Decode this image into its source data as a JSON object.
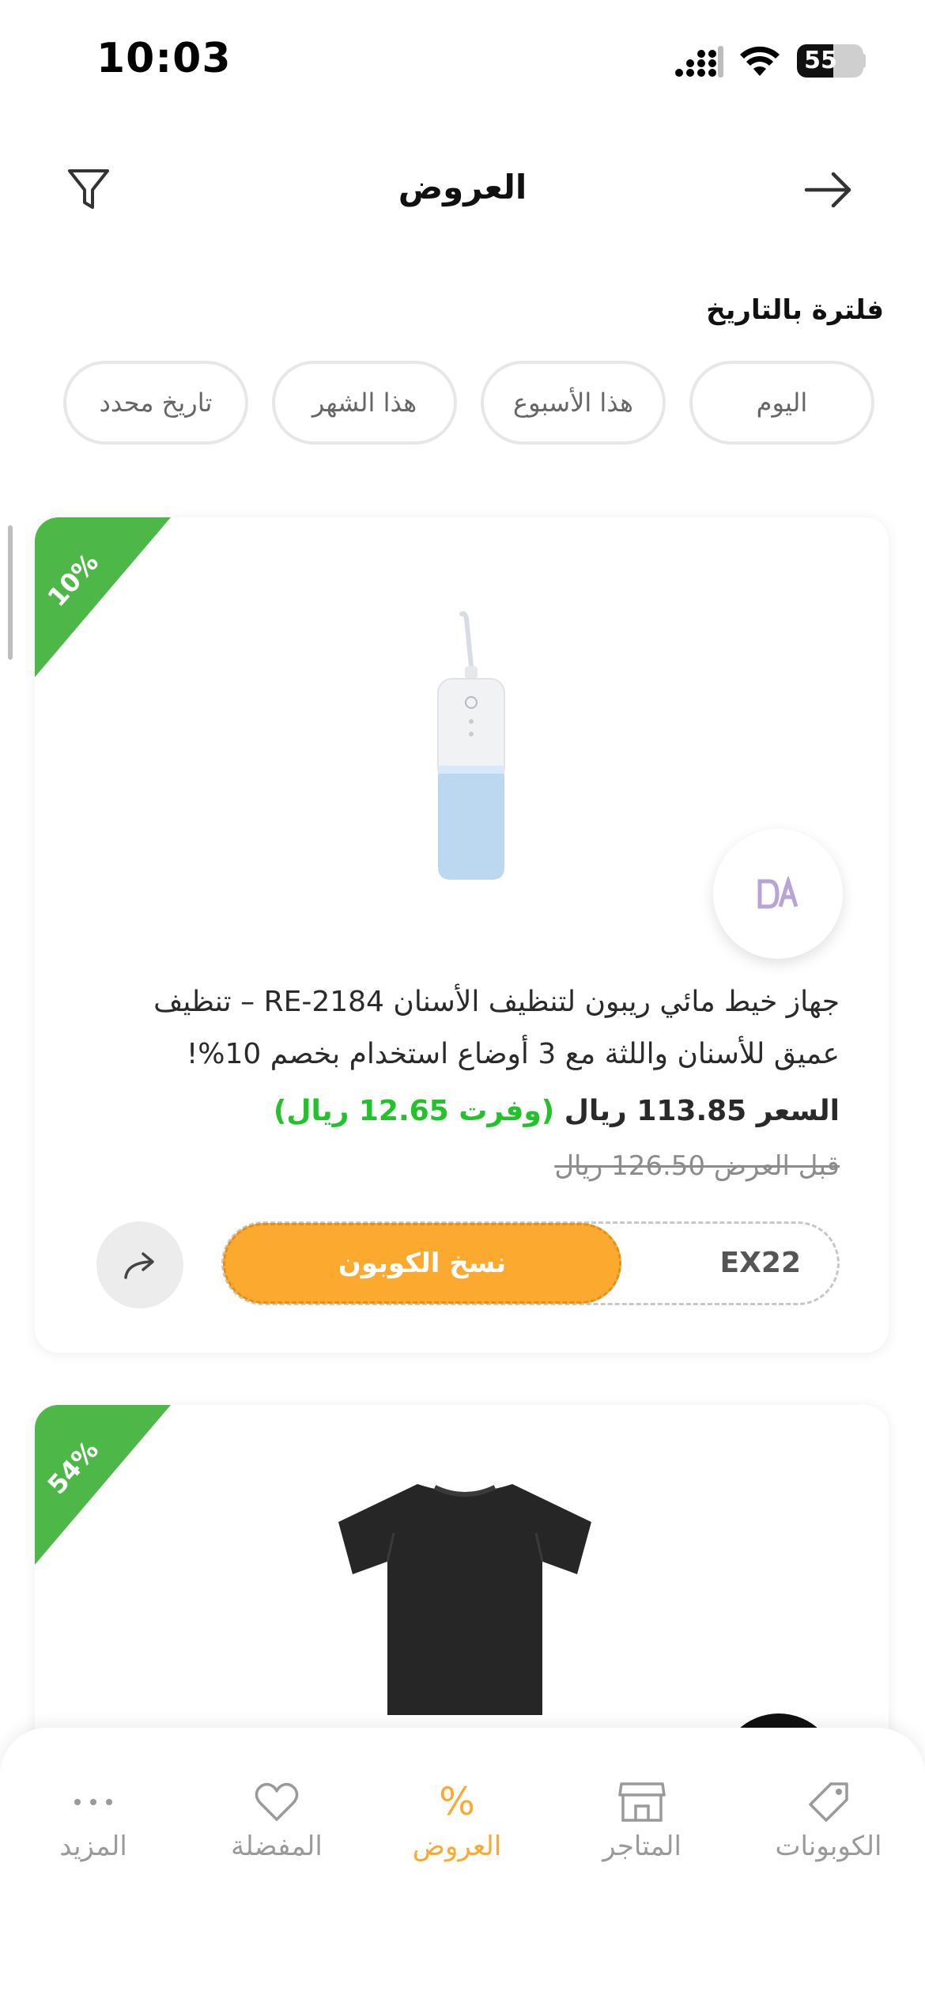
{
  "status_bar": {
    "time": "10:03",
    "battery": "55",
    "battery_level": 0.55
  },
  "header": {
    "title": "العروض"
  },
  "filter": {
    "label": "فلترة بالتاريخ",
    "chips": [
      "اليوم",
      "هذا الأسبوع",
      "هذا الشهر",
      "تاريخ محدد"
    ]
  },
  "offers": [
    {
      "discount": "10%",
      "description": "جهاز خيط مائي ريبون لتنظيف الأسنان RE-2184 – تنظيف عميق للأسنان واللثة مع 3 أوضاع استخدام بخصم 10%!",
      "price_prefix": "السعر",
      "price": "113.85 ريال",
      "saved": "(وفرت 12.65 ريال)",
      "before_price": "قبل العرض 126.50 ريال",
      "coupon_code": "EX22",
      "copy_label": "نسخ الكوبون"
    },
    {
      "discount": "54%"
    }
  ],
  "bottom_nav": {
    "items": [
      {
        "label": "الكوبونات",
        "icon": "tag-icon"
      },
      {
        "label": "المتاجر",
        "icon": "store-icon"
      },
      {
        "label": "العروض",
        "icon": "percent-icon",
        "active": true
      },
      {
        "label": "المفضلة",
        "icon": "heart-icon"
      },
      {
        "label": "المزيد",
        "icon": "more-dots-icon"
      }
    ]
  },
  "colors": {
    "accent": "#fba92f",
    "ribbon": "#4db848",
    "saved_text": "#22c22a"
  }
}
